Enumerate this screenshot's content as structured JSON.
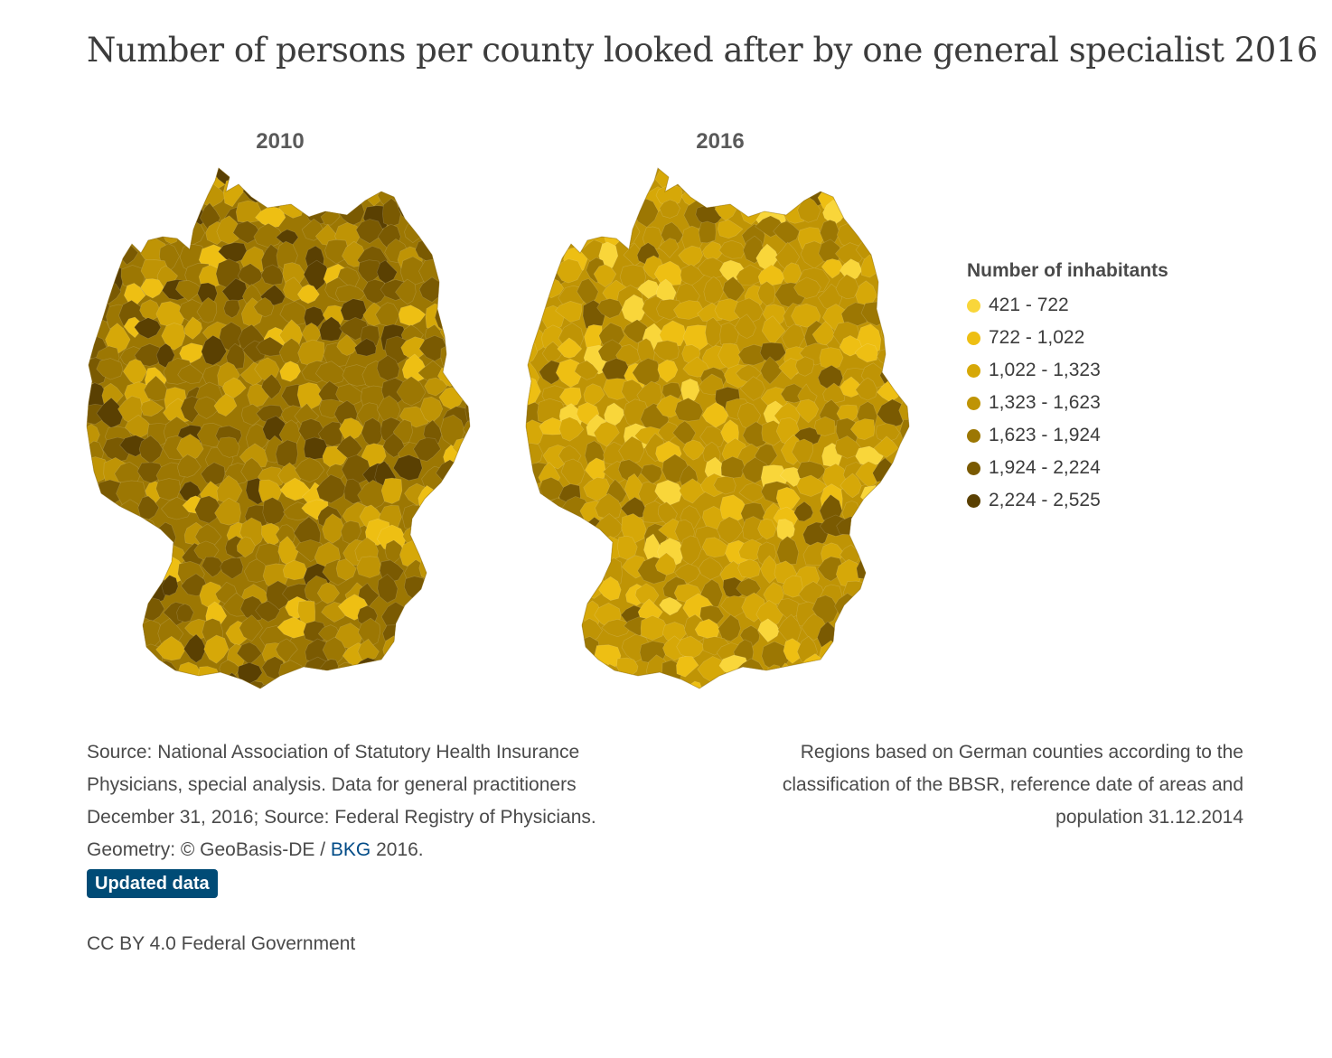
{
  "title": "Number of persons per county looked after by one general specialist 2016",
  "maps": [
    {
      "year": "2010",
      "tone": "dark"
    },
    {
      "year": "2016",
      "tone": "light"
    }
  ],
  "legend": {
    "title": "Number of inhabitants",
    "items": [
      {
        "label": "421 - 722",
        "color": "#f9d63a"
      },
      {
        "label": "722 - 1,022",
        "color": "#eebf13"
      },
      {
        "label": "1,022 - 1,323",
        "color": "#d6a808"
      },
      {
        "label": "1,323 - 1,623",
        "color": "#bf9405"
      },
      {
        "label": "1,623 - 1,924",
        "color": "#9c7703"
      },
      {
        "label": "1,924 - 2,224",
        "color": "#7a5a02"
      },
      {
        "label": "2,224 - 2,525",
        "color": "#5a4002"
      }
    ]
  },
  "source": {
    "text": "Source: National Association of Statutory Health Insurance Physicians, special analysis. Data for general practitioners December 31, 2016; Source: Federal Registry of Physicians. Geometry: © GeoBasis-DE / ",
    "link": "BKG",
    "text_after": " 2016.",
    "badge": "Updated data"
  },
  "regions_note": "Regions based on German counties according to the classification of the BBSR, reference date of areas and population 31.12.2014",
  "license": "CC BY 4.0 Federal Government"
}
